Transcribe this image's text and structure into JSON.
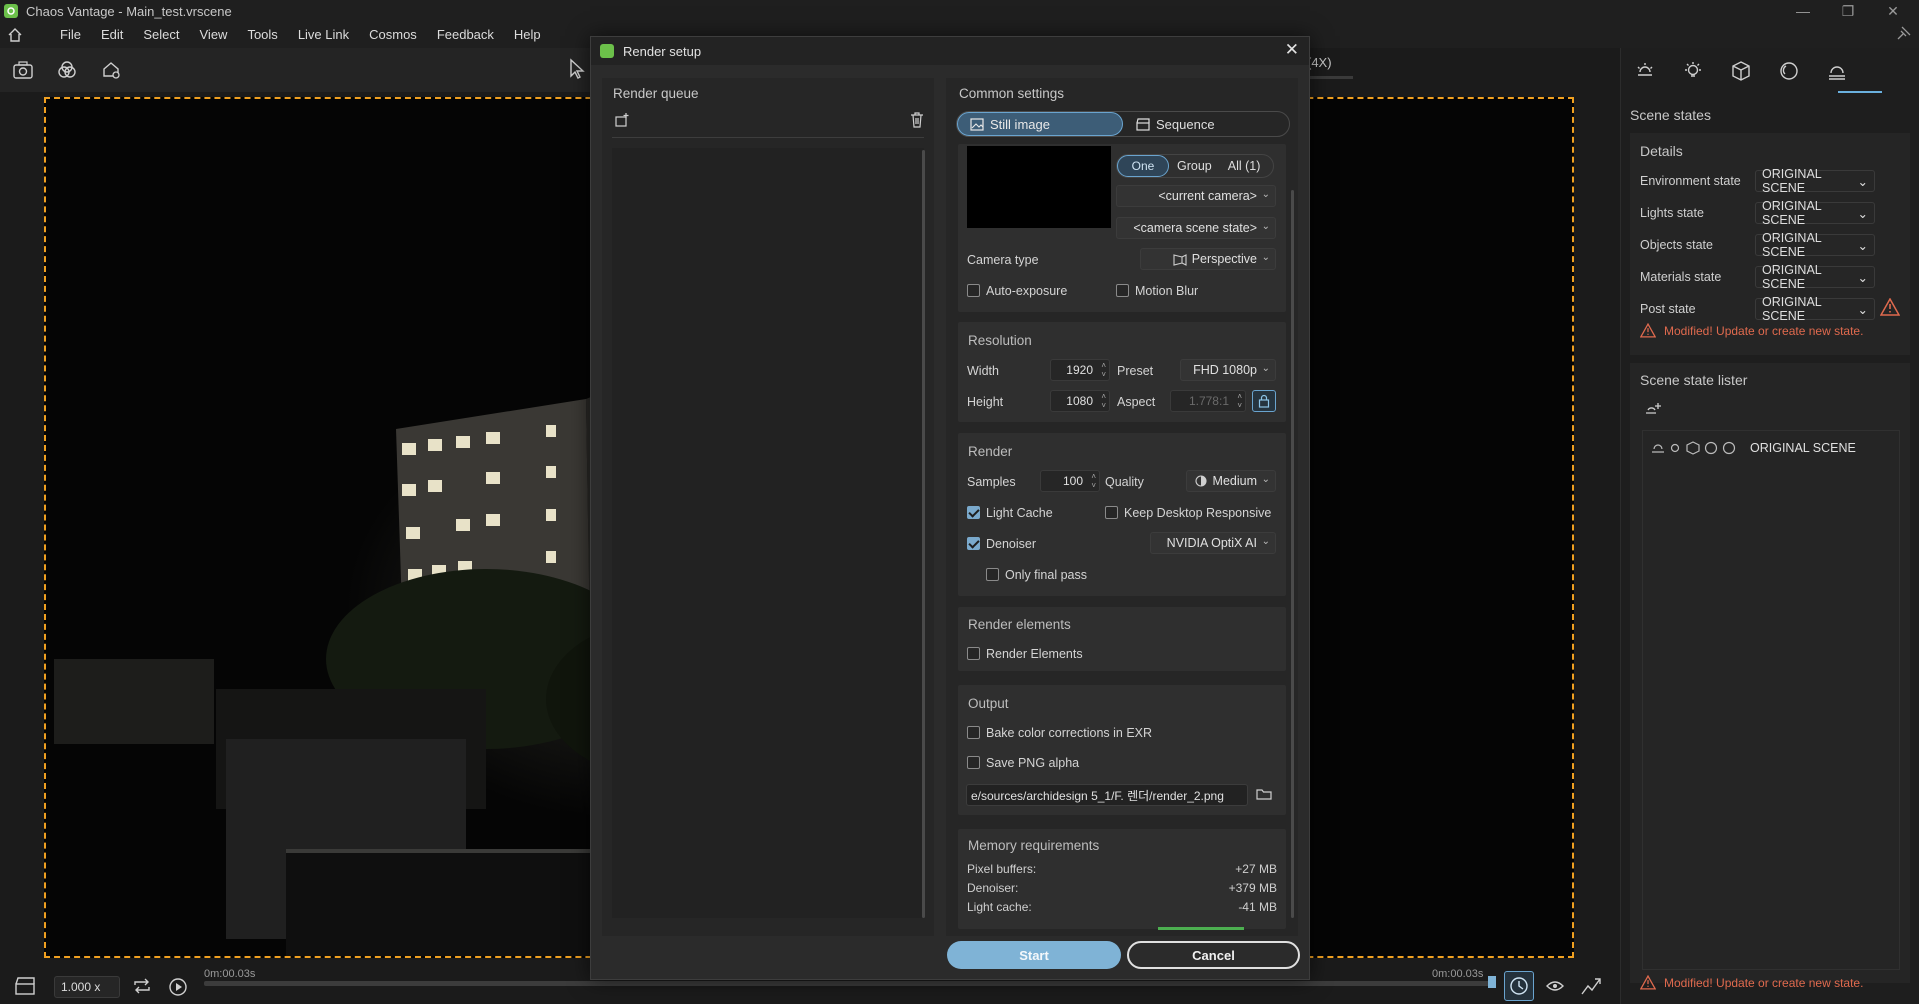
{
  "app": {
    "window_title": "Chaos Vantage - Main_test.vrscene",
    "controls": {
      "minimize": "—",
      "restore": "❐",
      "close": "✕"
    }
  },
  "menu": [
    "File",
    "Edit",
    "Select",
    "View",
    "Tools",
    "Live Link",
    "Cosmos",
    "Feedback",
    "Help"
  ],
  "viewport": {
    "zoom_label": "(4X)"
  },
  "timeline": {
    "speed": "1.000 x",
    "start_time": "0m:00.03s",
    "end_time": "0m:00.03s"
  },
  "right_panel": {
    "section_title": "Scene states",
    "details_title": "Details",
    "rows": [
      {
        "label": "Environment state",
        "value": "ORIGINAL SCENE"
      },
      {
        "label": "Lights state",
        "value": "ORIGINAL SCENE"
      },
      {
        "label": "Objects state",
        "value": "ORIGINAL SCENE"
      },
      {
        "label": "Materials state",
        "value": "ORIGINAL SCENE"
      },
      {
        "label": "Post state",
        "value": "ORIGINAL SCENE"
      }
    ],
    "warning": "Modified! Update or create new state.",
    "lister_title": "Scene state lister",
    "lister_item": "ORIGINAL SCENE",
    "bottom_warning": "Modified! Update or create new state."
  },
  "dialog": {
    "title": "Render setup",
    "queue_title": "Render queue",
    "common_title": "Common settings",
    "mode_still": "Still image",
    "mode_sequence": "Sequence",
    "camera": {
      "seg_one": "One",
      "seg_group": "Group",
      "seg_all": "All (1)",
      "current_camera": "<current camera>",
      "scene_state": "<camera scene state>",
      "type_label": "Camera type",
      "type_value": "Perspective",
      "auto_exposure": "Auto-exposure",
      "motion_blur": "Motion Blur"
    },
    "resolution": {
      "title": "Resolution",
      "width_label": "Width",
      "width": "1920",
      "height_label": "Height",
      "height": "1080",
      "preset_label": "Preset",
      "preset": "FHD 1080p",
      "aspect_label": "Aspect",
      "aspect": "1.778:1"
    },
    "render": {
      "title": "Render",
      "samples_label": "Samples",
      "samples": "100",
      "quality_label": "Quality",
      "quality": "Medium",
      "light_cache": "Light Cache",
      "light_cache_checked": true,
      "keep_desktop": "Keep Desktop Responsive",
      "keep_desktop_checked": false,
      "denoiser": "Denoiser",
      "denoiser_checked": true,
      "denoiser_value": "NVIDIA OptiX AI",
      "only_final": "Only final pass",
      "only_final_checked": false
    },
    "elements": {
      "title": "Render elements",
      "checkbox": "Render Elements"
    },
    "output": {
      "title": "Output",
      "bake": "Bake color corrections in EXR",
      "png_alpha": "Save PNG alpha",
      "path": "e/sources/archidesign 5_1/F. 렌더/render_2.png"
    },
    "memory": {
      "title": "Memory requirements",
      "rows": [
        {
          "label": "Pixel buffers:",
          "value": "+27 MB"
        },
        {
          "label": "Denoiser:",
          "value": "+379 MB"
        },
        {
          "label": "Light cache:",
          "value": "-41 MB"
        }
      ]
    },
    "start": "Start",
    "cancel": "Cancel"
  }
}
